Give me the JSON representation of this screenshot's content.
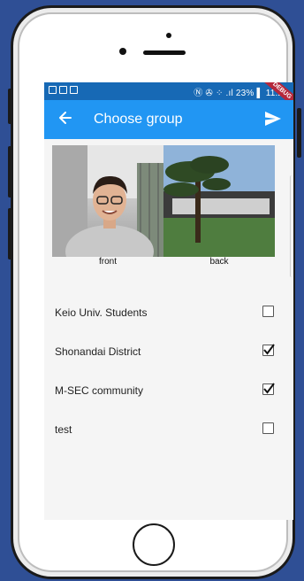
{
  "status_bar": {
    "right_text": "Ⓝ ✇ ⁘ .ıl 23% ▌ 11:20",
    "debug_label": "DEBUG"
  },
  "app_bar": {
    "title": "Choose group",
    "back_icon": "back-arrow-icon",
    "send_icon": "send-icon"
  },
  "photos": [
    {
      "label": "front"
    },
    {
      "label": "back"
    }
  ],
  "groups": [
    {
      "name": "Keio Univ. Students",
      "checked": false
    },
    {
      "name": "Shonandai District",
      "checked": true
    },
    {
      "name": "M-SEC community",
      "checked": true
    },
    {
      "name": "test",
      "checked": false
    }
  ],
  "colors": {
    "app_bar": "#2196f3",
    "status_bar": "#1769b5",
    "background": "#2f4f95"
  }
}
